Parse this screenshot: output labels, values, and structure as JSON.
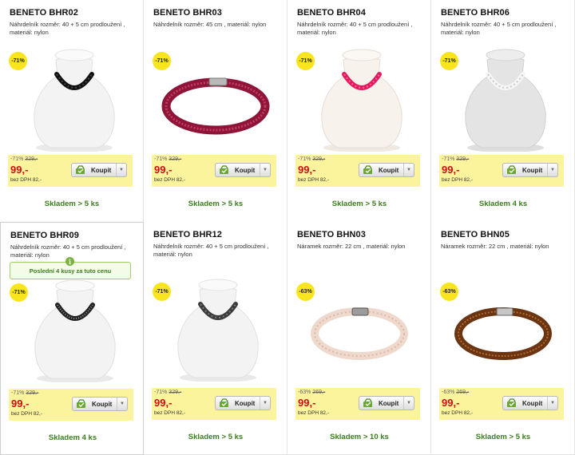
{
  "buy_label": "Koupit",
  "colors": {
    "badge": "#f9e51d",
    "price_box": "#fcf49c",
    "price": "#d20b12",
    "stock": "#3a7d1e"
  },
  "icons": {
    "buy": "cart-check-icon",
    "dropdown": "caret-down-icon",
    "info": "info-icon"
  },
  "tooltip": {
    "text": "Poslední 4 kusy za tuto cenu",
    "icon_text": "i"
  },
  "products": [
    {
      "name": "BENETO BHR02",
      "desc": "Náhrdelník rozměr: 40 + 5 cm prodloužení , materiál: nylon",
      "badge": "-71%",
      "discount": "-71%",
      "old_price": "329,-",
      "price": "99,-",
      "vat": "bez DPH 82,-",
      "stock": "Skladem > 5 ks",
      "image": "necklace-black-on-bust"
    },
    {
      "name": "BENETO BHR03",
      "desc": "Náhrdelník rozměr: 45 cm , materiál: nylon",
      "badge": "-71%",
      "discount": "-71%",
      "old_price": "329,-",
      "price": "99,-",
      "vat": "bez DPH 82,-",
      "stock": "Skladem > 5 ks",
      "image": "bracelet-ring-burgundy"
    },
    {
      "name": "BENETO BHR04",
      "desc": "Náhrdelník rozměr: 40 + 5 cm prodloužení , materiál: nylon",
      "badge": "-71%",
      "discount": "-71%",
      "old_price": "329,-",
      "price": "99,-",
      "vat": "bez DPH 82,-",
      "stock": "Skladem > 5 ks",
      "image": "necklace-pink-on-bust"
    },
    {
      "name": "BENETO BHR06",
      "desc": "Náhrdelník rozměr: 40 + 5 cm prodloužení , materiál: nylon",
      "badge": "-71%",
      "discount": "-71%",
      "old_price": "329,-",
      "price": "99,-",
      "vat": "bez DPH 82,-",
      "stock": "Skladem 4 ks",
      "image": "necklace-white-on-bust"
    },
    {
      "name": "BENETO BHR09",
      "desc": "Náhrdelník rozměr: 40 + 5 cm prodloužení , materiál: nylon",
      "badge": "-71%",
      "discount": "-71%",
      "old_price": "329,-",
      "price": "99,-",
      "vat": "bez DPH 82,-",
      "stock": "Skladem 4 ks",
      "image": "necklace-black-glitter-on-bust"
    },
    {
      "name": "BENETO BHR12",
      "desc": "Náhrdelník rozměr: 40 + 5 cm prodloužení , materiál: nylon",
      "badge": "-71%",
      "discount": "-71%",
      "old_price": "329,-",
      "price": "99,-",
      "vat": "bez DPH 82,-",
      "stock": "Skladem > 5 ks",
      "image": "necklace-darkgrey-on-bust"
    },
    {
      "name": "BENETO BHN03",
      "desc": "Náramek rozměr: 22 cm , materiál: nylon",
      "badge": "-63%",
      "discount": "-63%",
      "old_price": "269,-",
      "price": "99,-",
      "vat": "bez DPH 82,-",
      "stock": "Skladem > 10 ks",
      "image": "bracelet-ring-peach"
    },
    {
      "name": "BENETO BHN05",
      "desc": "Náramek rozměr: 22 cm , materiál: nylon",
      "badge": "-63%",
      "discount": "-63%",
      "old_price": "269,-",
      "price": "99,-",
      "vat": "bez DPH 82,-",
      "stock": "Skladem > 5 ks",
      "image": "bracelet-ring-brown"
    }
  ]
}
